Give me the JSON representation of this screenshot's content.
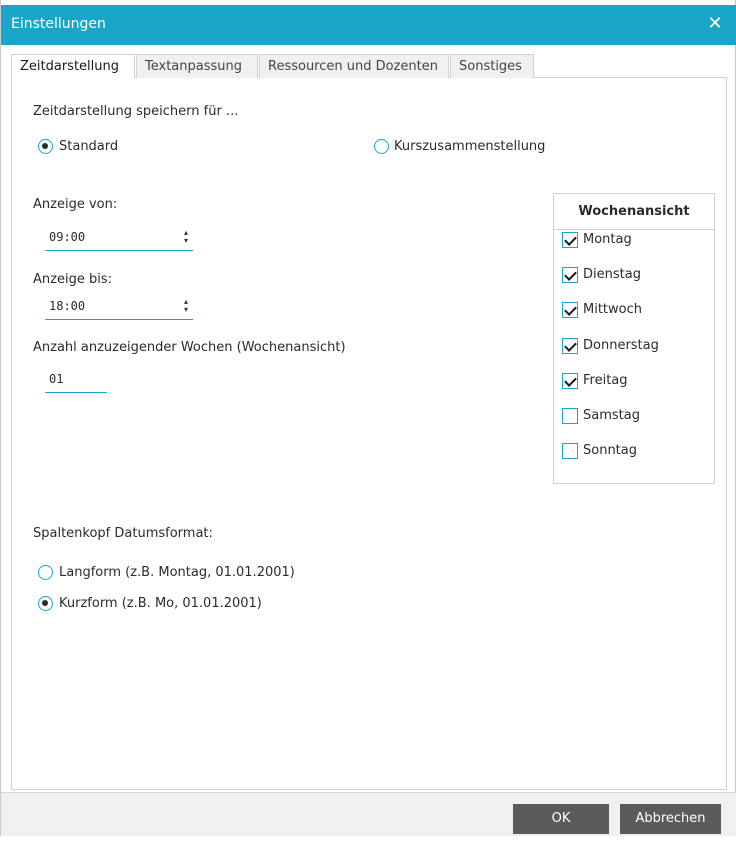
{
  "window": {
    "title": "Einstellungen",
    "close_glyph": "✕"
  },
  "tabs": [
    {
      "label": "Zeitdarstellung",
      "active": true
    },
    {
      "label": "Textanpassung",
      "active": false
    },
    {
      "label": "Ressourcen und Dozenten",
      "active": false
    },
    {
      "label": "Sonstiges",
      "active": false
    }
  ],
  "save_for": {
    "label": "Zeitdarstellung speichern für ...",
    "options": [
      {
        "label": "Standard",
        "checked": true
      },
      {
        "label": "Kurszusammenstellung",
        "checked": false
      }
    ]
  },
  "display_from": {
    "label": "Anzeige von:",
    "value": "09:00"
  },
  "display_to": {
    "label": "Anzeige bis:",
    "value": "18:00"
  },
  "weeks": {
    "label": "Anzahl anzuzeigender Wochen (Wochenansicht)",
    "value": "01"
  },
  "week_view": {
    "title": "Wochenansicht",
    "days": [
      {
        "label": "Montag",
        "checked": true
      },
      {
        "label": "Dienstag",
        "checked": true
      },
      {
        "label": "Mittwoch",
        "checked": true
      },
      {
        "label": "Donnerstag",
        "checked": true
      },
      {
        "label": "Freitag",
        "checked": true
      },
      {
        "label": "Samstag",
        "checked": false
      },
      {
        "label": "Sonntag",
        "checked": false
      }
    ]
  },
  "date_format": {
    "label": "Spaltenkopf Datumsformat:",
    "options": [
      {
        "label": "Langform (z.B. Montag, 01.01.2001)",
        "checked": false
      },
      {
        "label": "Kurzform (z.B. Mo, 01.01.2001)",
        "checked": true
      }
    ]
  },
  "buttons": {
    "ok": "OK",
    "cancel": "Abbrechen"
  },
  "colors": {
    "accent": "#1aa6c8",
    "button": "#5b5b5b"
  }
}
